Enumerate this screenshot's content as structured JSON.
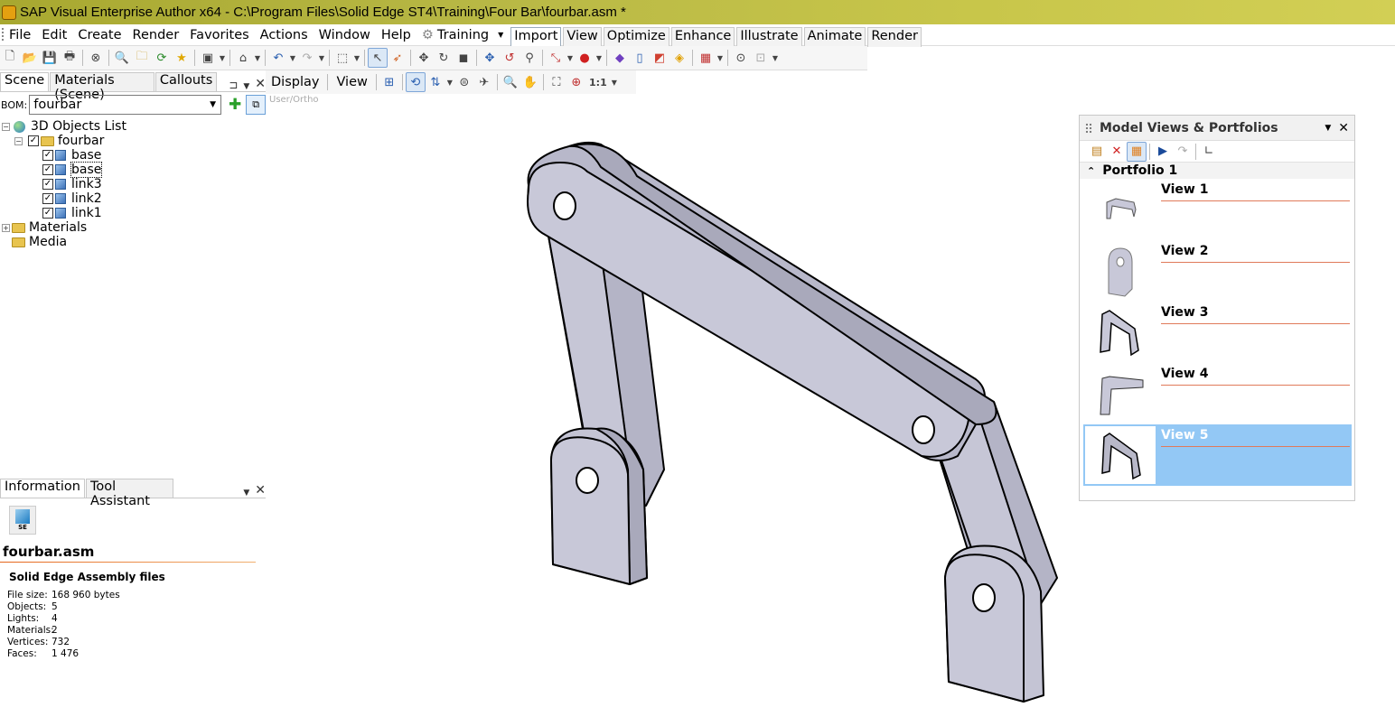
{
  "window": {
    "title": "SAP Visual Enterprise Author x64 - C:\\Program Files\\Solid Edge ST4\\Training\\Four Bar\\fourbar.asm *"
  },
  "menu": {
    "items": [
      "File",
      "Edit",
      "Create",
      "Render",
      "Favorites",
      "Actions",
      "Window",
      "Help",
      "Training"
    ],
    "ribbon_tabs": [
      "Import",
      "View",
      "Optimize",
      "Enhance",
      "Illustrate",
      "Animate",
      "Render"
    ],
    "active_ribbon": "Import"
  },
  "toolbar2": {
    "display": "Display",
    "view": "View",
    "one_to_one": "1:1"
  },
  "scene_panel": {
    "tabs": [
      "Scene",
      "Materials (Scene)",
      "Callouts"
    ],
    "bom_label": "BOM:",
    "bom_value": "fourbar",
    "tree": {
      "root": "3D Objects List",
      "assembly": "fourbar",
      "parts": [
        "base",
        "base",
        "link3",
        "link2",
        "link1"
      ],
      "materials": "Materials",
      "media": "Media"
    }
  },
  "info_panel": {
    "tabs": [
      "Information",
      "Tool Assistant"
    ],
    "icon_label": "SE",
    "filename": "fourbar.asm",
    "file_type": "Solid Edge Assembly files",
    "props": [
      {
        "k": "File size:",
        "v": "168 960 bytes"
      },
      {
        "k": "Objects:",
        "v": "5"
      },
      {
        "k": "Lights:",
        "v": "4"
      },
      {
        "k": "Materials:",
        "v": "2"
      },
      {
        "k": "Vertices:",
        "v": "732"
      },
      {
        "k": "Faces:",
        "v": "1 476"
      }
    ]
  },
  "viewport": {
    "label": "User/Ortho"
  },
  "model_views": {
    "title": "Model Views & Portfolios",
    "portfolio": "Portfolio 1",
    "views": [
      "View 1",
      "View 2",
      "View 3",
      "View 4",
      "View 5"
    ],
    "selected": 4
  },
  "colors": {
    "accent": "#93c8f5",
    "model_face": "#c8c8d8",
    "model_face_dark": "#a9a9bb"
  }
}
